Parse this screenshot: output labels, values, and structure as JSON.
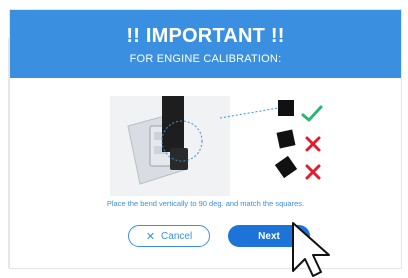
{
  "dialog": {
    "title": "!! IMPORTANT !!",
    "subtitle": "FOR ENGINE CALIBRATION:",
    "instruction": "Place the bend vertically to 90 deg. and match the squares.",
    "buttons": {
      "cancel_label": "Cancel",
      "cancel_icon": "x-icon",
      "next_label": "Next"
    },
    "status_icons": {
      "ok": "check-icon",
      "bad": "cross-icon"
    },
    "colors": {
      "header": "#3b8fe0",
      "primary": "#1d74d8",
      "check": "#2bb673",
      "cross": "#e21b2e"
    }
  }
}
